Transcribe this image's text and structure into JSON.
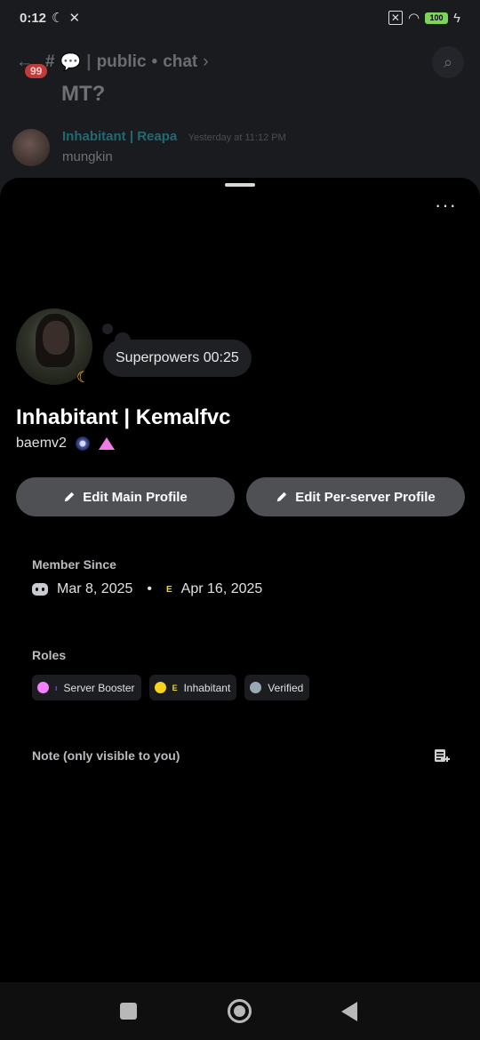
{
  "status_bar": {
    "time": "0:12",
    "battery": "100"
  },
  "channel_header": {
    "badge": "99",
    "channel": "public",
    "separator": "•",
    "subchannel": "chat",
    "chevron": "›"
  },
  "background_chat": {
    "prev_message_tail": "MT?",
    "message": {
      "author": "Inhabitant | Reapa",
      "timestamp": "Yesterday at 11:12 PM",
      "content": "mungkin"
    }
  },
  "profile": {
    "custom_status": "Superpowers 00:25",
    "display_name": "Inhabitant | Kemalfvc",
    "username": "baemv2",
    "buttons": {
      "edit_main": "Edit Main Profile",
      "edit_server": "Edit Per-server Profile"
    },
    "member_since": {
      "label": "Member Since",
      "discord_date": "Mar 8, 2025",
      "separator": "•",
      "server_date": "Apr 16, 2025"
    },
    "roles": {
      "label": "Roles",
      "items": [
        {
          "name": "Server Booster",
          "color": "#f47fff"
        },
        {
          "name": "Inhabitant",
          "color": "#f6d320"
        },
        {
          "name": "Verified",
          "color": "#99aab5"
        }
      ]
    },
    "note": {
      "label": "Note (only visible to you)"
    }
  },
  "icons": [
    "back-arrow-icon",
    "hash-icon",
    "chat-bubble-icon",
    "search-icon",
    "more-icon",
    "moon-icon",
    "pencil-icon",
    "discord-icon",
    "note-add-icon"
  ]
}
